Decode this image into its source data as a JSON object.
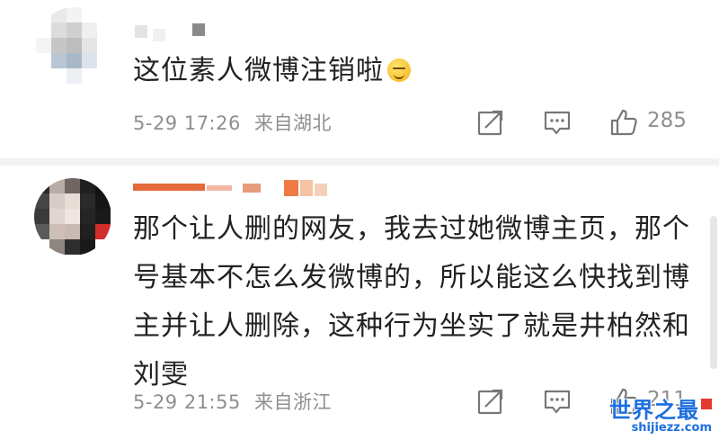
{
  "comments": [
    {
      "text": "这位素人微博注销啦",
      "emoji": "smiling-face-emoji",
      "date": "5-29 17:26",
      "location": "来自湖北",
      "likes": "285"
    },
    {
      "text": "那个让人删的网友，我去过她微博主页，那个号基本不怎么发微博的，所以能这么快找到博主并让人删除，这种行为坐实了就是井柏然和刘雯",
      "date": "5-29 21:55",
      "location": "来自浙江",
      "likes": "211"
    }
  ],
  "icons": [
    "share-icon",
    "comment-icon",
    "like-icon"
  ],
  "colors": {
    "text": "#222222",
    "meta": "#8f8f8f",
    "watermark": "#1d6fe0"
  },
  "watermark": {
    "title": "世界之最",
    "url": "shijiezz.com"
  }
}
